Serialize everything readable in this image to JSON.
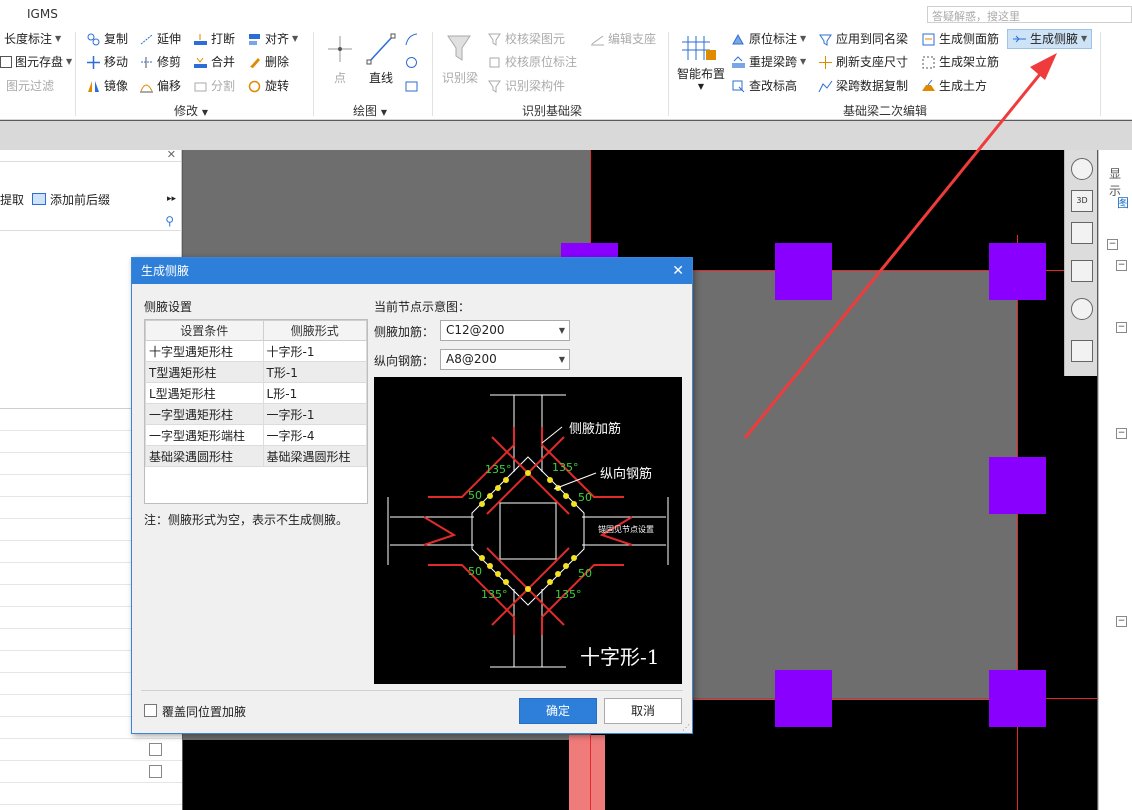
{
  "app": {
    "name": "IGMS",
    "help_search_placeholder": "答疑解惑，搜这里"
  },
  "ribbon": {
    "left_col": {
      "length_label": "长度标注",
      "save_element": "图元存盘",
      "filter": "图元过滤"
    },
    "modify": {
      "copy": "复制",
      "extend": "延伸",
      "break": "打断",
      "align": "对齐",
      "move": "移动",
      "trim": "修剪",
      "merge": "合并",
      "delete": "删除",
      "mirror": "镜像",
      "offset": "偏移",
      "split": "分割",
      "rotate": "旋转",
      "group_label": "修改"
    },
    "draw": {
      "point": "点",
      "line": "直线",
      "group_label": "绘图"
    },
    "recognize": {
      "recognize_beam": "识别梁",
      "check_beam_element": "校核梁图元",
      "edit_support": "编辑支座",
      "check_origin_mark": "校核原位标注",
      "recognize_beam_member": "识别梁构件",
      "group_label": "识别基础梁"
    },
    "edit2": {
      "smart_layout": "智能布置",
      "origin_mark": "原位标注",
      "apply_same_name": "应用到同名梁",
      "gen_side_rebar": "生成侧面筋",
      "gen_haunch": "生成侧腋",
      "re_span": "重提梁跨",
      "refresh_support_size": "刷新支座尺寸",
      "gen_stirrup_bar": "生成架立筋",
      "check_elevation": "查改标高",
      "span_data_copy": "梁跨数据复制",
      "gen_earthwork": "生成土方",
      "group_label": "基础梁二次编辑"
    }
  },
  "left_panel": {
    "extract": "提取",
    "add_prefix_suffix": "添加前后缀"
  },
  "right_panel": {
    "tab_display": "显示",
    "tab_layer": "图"
  },
  "view_tools": {
    "three_d": "3D"
  },
  "dialog": {
    "title": "生成侧腋",
    "settings_label": "侧腋设置",
    "table": {
      "headers": [
        "设置条件",
        "侧腋形式"
      ],
      "rows": [
        [
          "十字型遇矩形柱",
          "十字形-1"
        ],
        [
          "T型遇矩形柱",
          "T形-1"
        ],
        [
          "L型遇矩形柱",
          "L形-1"
        ],
        [
          "一字型遇矩形柱",
          "一字形-1"
        ],
        [
          "一字型遇矩形端柱",
          "一字形-4"
        ],
        [
          "基础梁遇圆形柱",
          "基础梁遇圆形柱"
        ]
      ]
    },
    "note": "注：侧腋形式为空，表示不生成侧腋。",
    "diagram_label": "当前节点示意图：",
    "haunch_rebar_label": "侧腋加筋：",
    "haunch_rebar_value": "C12@200",
    "long_rebar_label": "纵向钢筋：",
    "long_rebar_value": "A8@200",
    "diagram": {
      "caption": "十字形-1",
      "label_haunch": "侧腋加筋",
      "label_long": "纵向钢筋",
      "label_anchor": "锚固见节点设置",
      "angle": "135°",
      "dist": "50"
    },
    "override_label": "覆盖同位置加腋",
    "ok": "确定",
    "cancel": "取消"
  },
  "colors": {
    "accent": "#2e7fd9",
    "column": "#8a00ff",
    "axis": "#e12a2a",
    "arrow": "#ef3b3b"
  }
}
